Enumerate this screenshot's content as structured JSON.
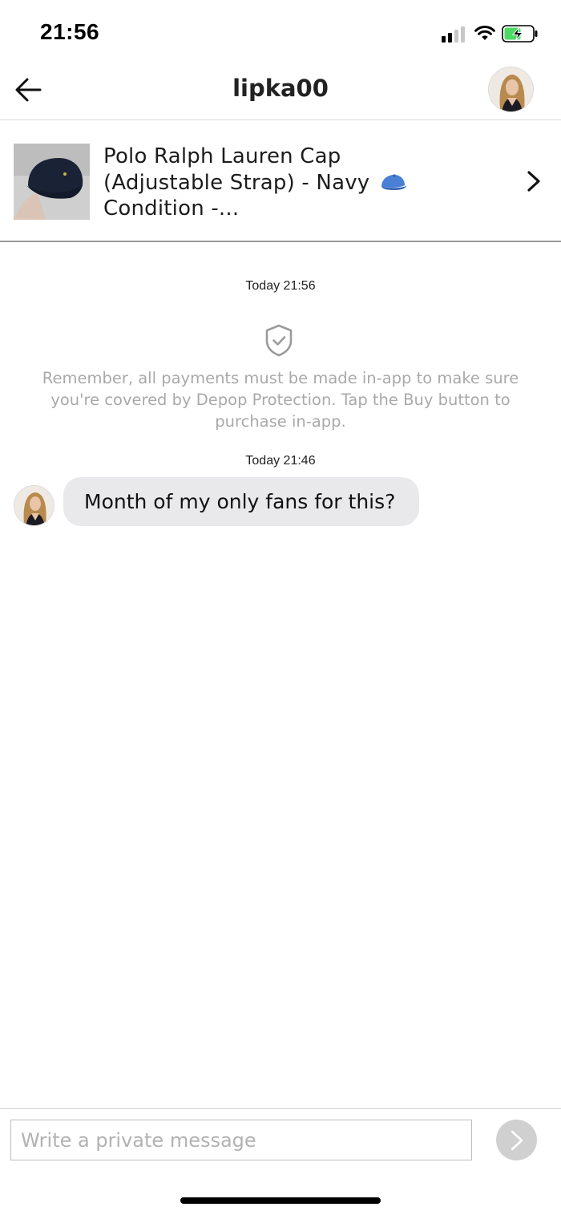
{
  "status_bar": {
    "time": "21:56",
    "icons": [
      "signal-icon",
      "wifi-icon",
      "battery-charging-icon"
    ],
    "battery_color": "#4cd964"
  },
  "header": {
    "title": "lipka00",
    "back_icon": "arrow-left-icon",
    "avatar": "user-avatar"
  },
  "product": {
    "title": "Polo Ralph Lauren Cap (Adjustable Strap) - Navy",
    "title_tail": "Condition -...",
    "emoji": "cap-icon",
    "thumb_color": "#1a2236",
    "accent": "#4a7fd6"
  },
  "conversation": {
    "system_timestamp": "Today 21:56",
    "protection_notice": "Remember, all payments must be made in-app to make sure you're covered by Depop Protection. Tap the Buy button to purchase in-app.",
    "message_timestamp": "Today 21:46",
    "messages": [
      {
        "sender": "lipka00",
        "text": "Month of my only fans for this?"
      }
    ]
  },
  "composer": {
    "placeholder": "Write a private message",
    "value": "",
    "send_icon": "chevron-right-icon"
  }
}
